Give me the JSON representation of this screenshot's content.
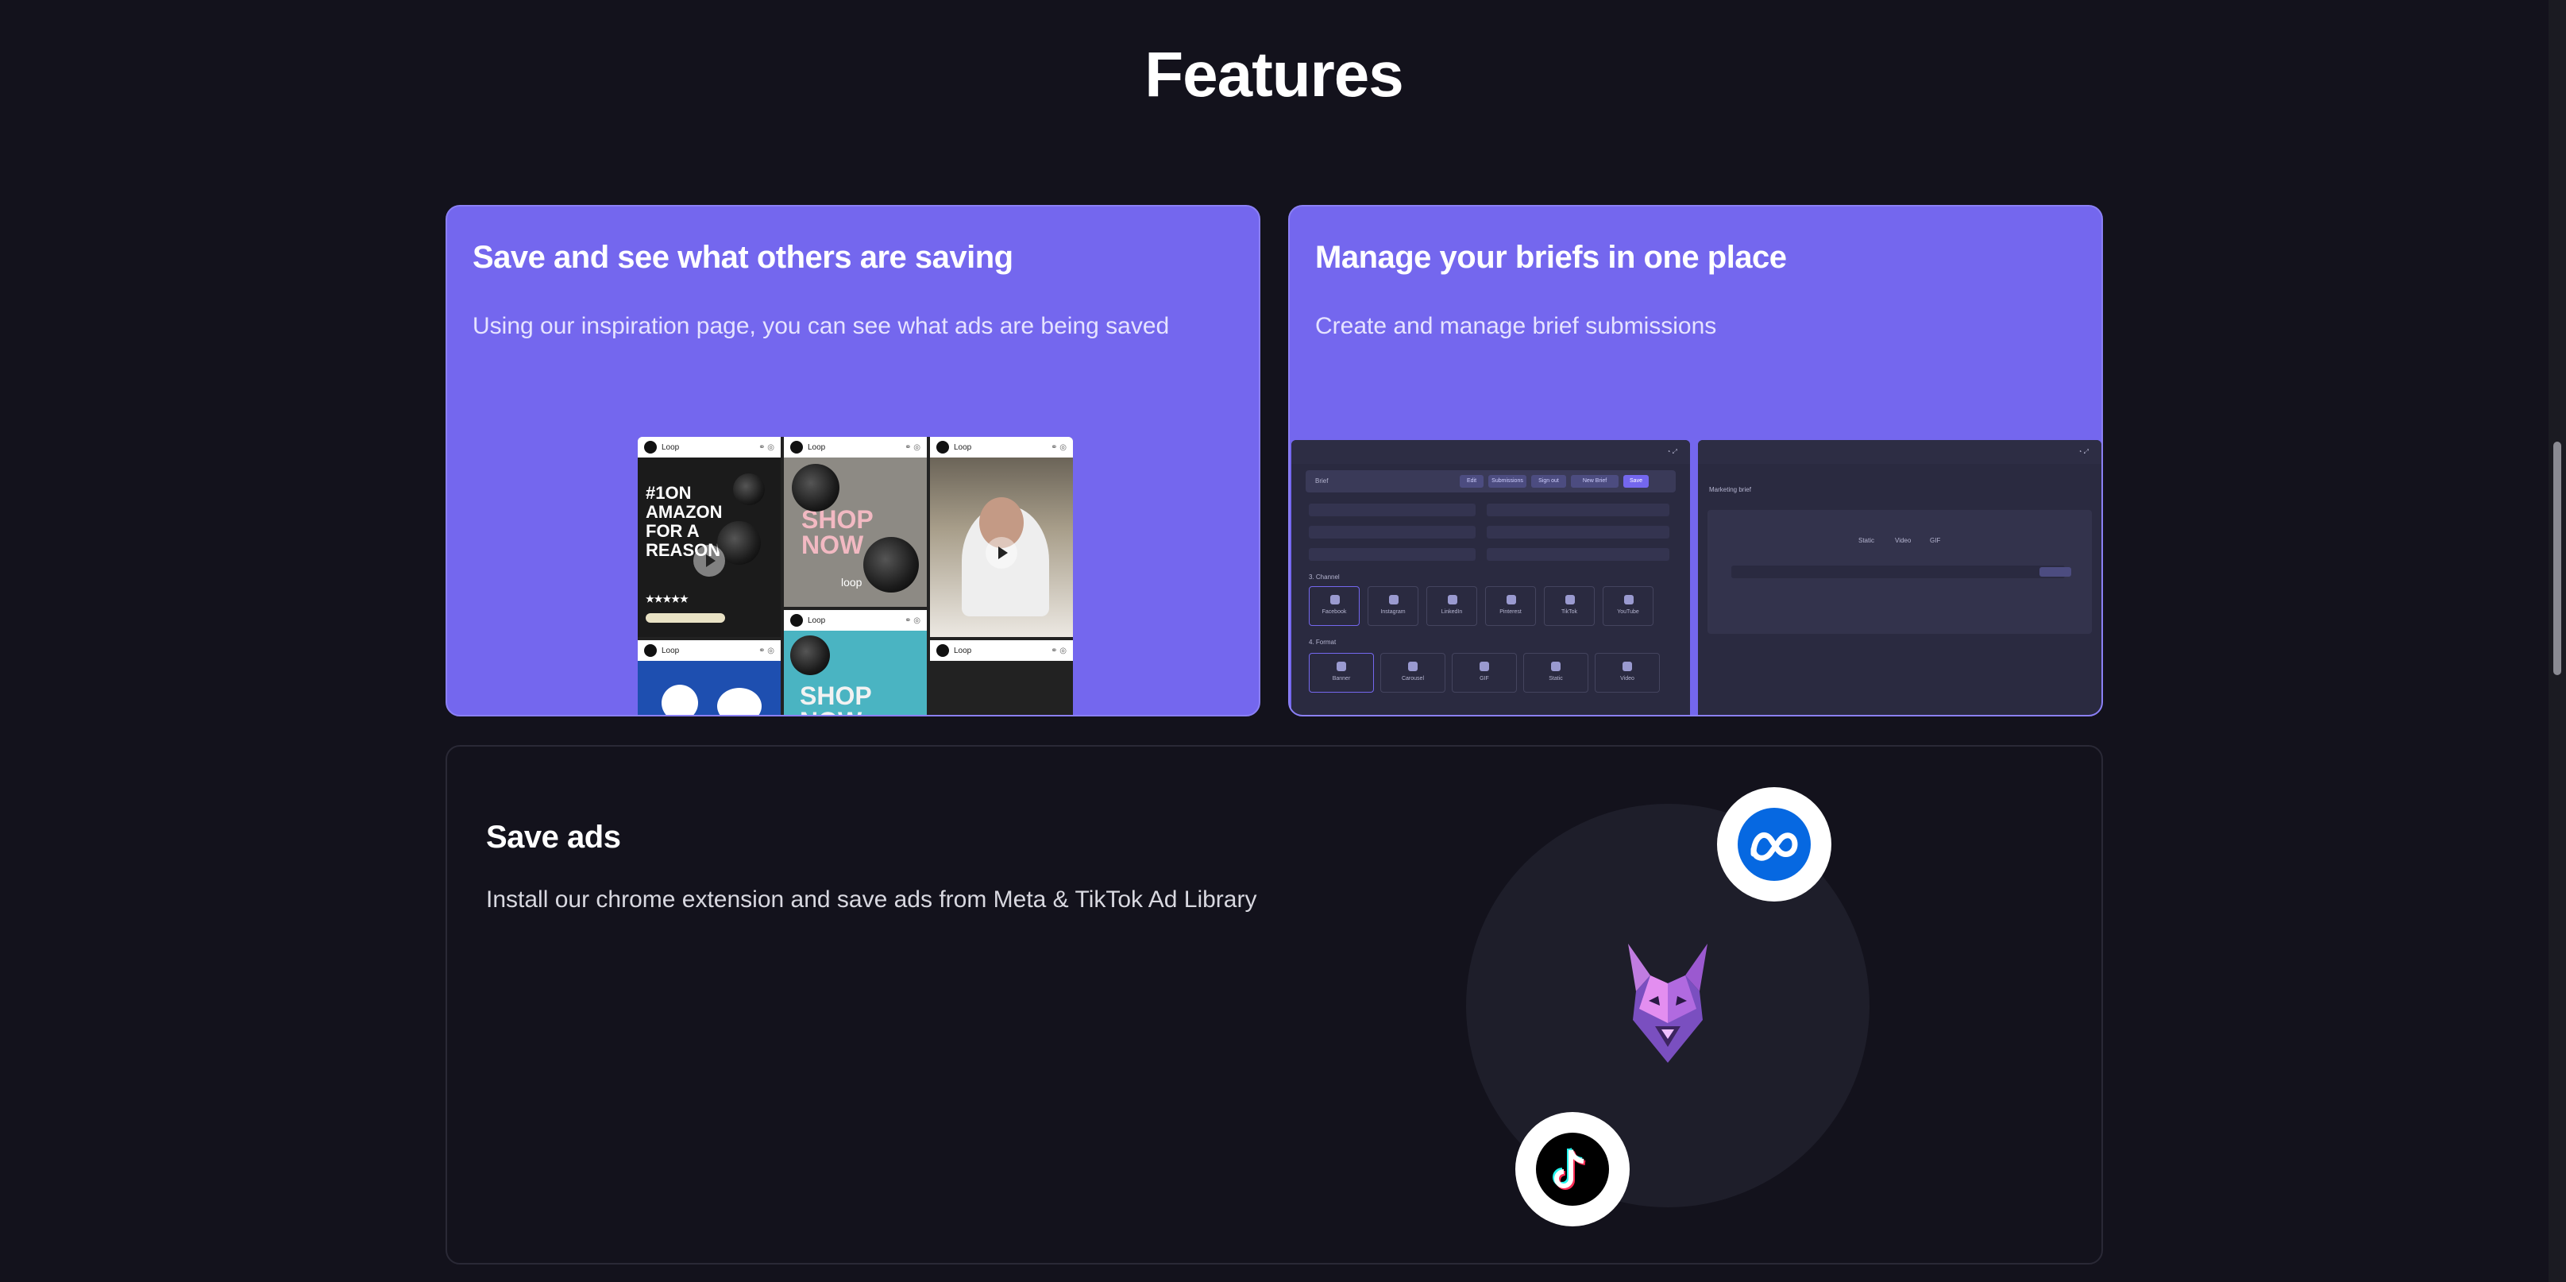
{
  "page": {
    "title": "Features"
  },
  "cards": {
    "inspiration": {
      "title": "Save and see what others are saving",
      "description": "Using our inspiration page, you can see what ads are being saved"
    },
    "briefs": {
      "title": "Manage your briefs in one place",
      "description": "Create and manage brief submissions"
    },
    "save_ads": {
      "title": "Save ads",
      "description": "Install our chrome extension and save ads from Meta & TikTok Ad Library"
    }
  },
  "inspiration_mock": {
    "brand": "Loop",
    "ad1": {
      "line1": "#1ON",
      "line2": "AMAZON",
      "line3": "FOR A",
      "line4": "REASON",
      "rating": "★★★★★"
    },
    "ad2": {
      "text": "SHOP NOW",
      "logo": "loop"
    },
    "ad3": {
      "text": "SHOP NOW"
    }
  },
  "briefs_mock": {
    "title": "Brief",
    "tabs": [
      "Edit",
      "Submissions",
      "Sign out",
      "New Brief",
      "Save"
    ],
    "channels": [
      "Facebook",
      "Instagram",
      "LinkedIn",
      "Pinterest",
      "TikTok",
      "YouTube"
    ],
    "formats": [
      "Banner",
      "Carousel",
      "GIF",
      "Static",
      "Video"
    ],
    "section_channel": "3. Channel",
    "section_format": "4. Format",
    "right_title": "Marketing brief",
    "right_options": [
      "Static",
      "Video",
      "GIF"
    ]
  },
  "icons": {
    "meta": "meta-logo-icon",
    "tiktok": "tiktok-logo-icon",
    "mascot": "wolf-mascot-icon"
  },
  "colors": {
    "accent": "#7467ee",
    "background": "#13121c",
    "meta_blue": "#0668e1"
  }
}
